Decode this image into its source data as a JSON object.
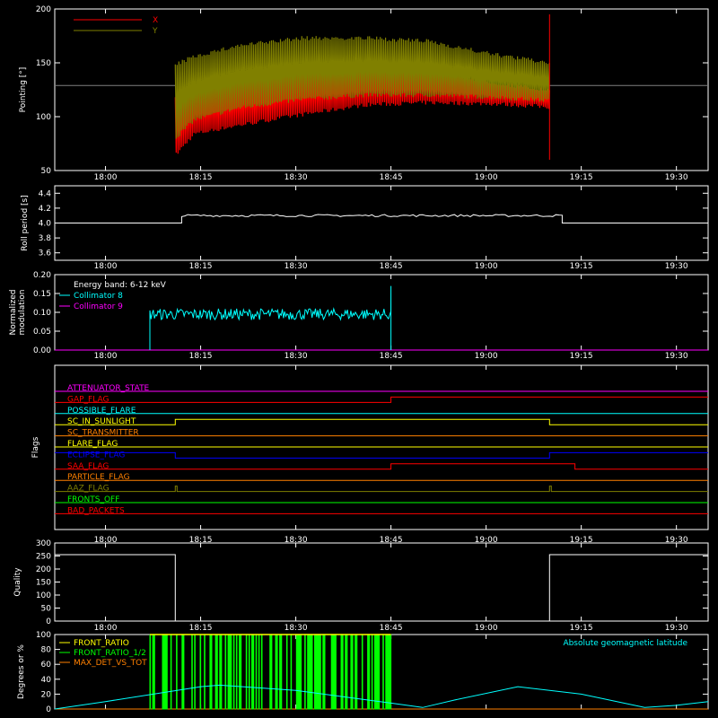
{
  "chart_data": [
    {
      "type": "line",
      "ylabel": "Pointing [°]",
      "ylim": [
        50,
        200
      ],
      "yticks": [
        50,
        100,
        150,
        200
      ],
      "legend": "top-left",
      "series": [
        {
          "name": "X",
          "color": "#ff0000",
          "baseline": 129,
          "start_time": "18:11",
          "end_time": "19:10",
          "lower": [
            [
              0,
              62
            ],
            [
              3,
              82
            ],
            [
              10,
              90
            ],
            [
              20,
              100
            ],
            [
              30,
              109
            ],
            [
              40,
              111
            ],
            [
              50,
              110
            ],
            [
              59,
              107
            ]
          ],
          "upper": [
            [
              0,
              118
            ],
            [
              3,
              130
            ],
            [
              10,
              138
            ],
            [
              20,
              145
            ],
            [
              30,
              147
            ],
            [
              40,
              145
            ],
            [
              50,
              134
            ],
            [
              59,
              126
            ]
          ]
        },
        {
          "name": "Y",
          "color": "#808000",
          "baseline": 129,
          "start_time": "18:11",
          "end_time": "19:10",
          "lower": [
            [
              0,
              78
            ],
            [
              3,
              95
            ],
            [
              10,
              106
            ],
            [
              20,
              114
            ],
            [
              30,
              118
            ],
            [
              40,
              118
            ],
            [
              50,
              116
            ],
            [
              59,
              113
            ]
          ],
          "upper": [
            [
              0,
              150
            ],
            [
              3,
              158
            ],
            [
              10,
              168
            ],
            [
              20,
              175
            ],
            [
              30,
              175
            ],
            [
              40,
              172
            ],
            [
              50,
              160
            ],
            [
              59,
              152
            ]
          ]
        }
      ]
    },
    {
      "type": "line",
      "ylabel": "Roll period [s]",
      "ylim": [
        3.5,
        4.5
      ],
      "yticks": [
        "3.6",
        "3.8",
        "4.0",
        "4.2",
        "4.4"
      ],
      "series": [
        {
          "name": "roll period",
          "color": "#ffffff",
          "level": 4.0,
          "noisy_start": "18:12",
          "noisy_end": "19:12",
          "noisy_level": 4.1
        }
      ]
    },
    {
      "type": "line",
      "ylabel_lines": [
        "Normalized",
        "modulation"
      ],
      "ylim": [
        0,
        0.2
      ],
      "yticks": [
        "0.00",
        "0.05",
        "0.10",
        "0.15",
        "0.20"
      ],
      "legend": "top-left",
      "annotation": "Energy band: 6-12 keV",
      "series": [
        {
          "name": "Collimator 8",
          "color": "#00ffff",
          "start_time": "18:07",
          "end_time": "18:45",
          "mean": 0.095,
          "spread": 0.015
        },
        {
          "name": "Collimator 9",
          "color": "#ff00ff",
          "level": 0.0
        }
      ]
    },
    {
      "type": "line",
      "ylabel": "Flags",
      "series": [
        {
          "name": "ATTENUATOR_STATE",
          "color": "#ff00ff",
          "steps": [
            [
              "17:52",
              0
            ],
            [
              "19:35",
              0
            ]
          ]
        },
        {
          "name": "GAP_FLAG",
          "color": "#ff0000",
          "steps": [
            [
              "17:52",
              0
            ],
            [
              "18:45",
              1
            ],
            [
              "19:35",
              1
            ]
          ]
        },
        {
          "name": "POSSIBLE_FLARE",
          "color": "#00ffff",
          "steps": [
            [
              "17:52",
              0
            ],
            [
              "19:35",
              0
            ]
          ]
        },
        {
          "name": "SC_IN_SUNLIGHT",
          "color": "#ffff00",
          "steps": [
            [
              "17:52",
              0
            ],
            [
              "18:11",
              1
            ],
            [
              "19:10",
              0
            ],
            [
              "19:35",
              0
            ]
          ]
        },
        {
          "name": "SC_TRANSMITTER",
          "color": "#ff8000",
          "steps": [
            [
              "17:52",
              0
            ],
            [
              "19:35",
              0
            ]
          ]
        },
        {
          "name": "FLARE_FLAG",
          "color": "#ffff00",
          "steps": [
            [
              "17:52",
              0
            ],
            [
              "19:35",
              0
            ]
          ]
        },
        {
          "name": "ECLIPSE_FLAG",
          "color": "#0000ff",
          "steps": [
            [
              "17:52",
              1
            ],
            [
              "18:11",
              0
            ],
            [
              "19:10",
              1
            ],
            [
              "19:35",
              1
            ]
          ]
        },
        {
          "name": "SAA_FLAG",
          "color": "#ff0000",
          "steps": [
            [
              "17:52",
              0
            ],
            [
              "18:45",
              1
            ],
            [
              "19:14",
              0
            ],
            [
              "19:35",
              0
            ]
          ]
        },
        {
          "name": "PARTICLE_FLAG",
          "color": "#ff8000",
          "steps": [
            [
              "17:52",
              0
            ],
            [
              "19:35",
              0
            ]
          ]
        },
        {
          "name": "AAZ_FLAG",
          "color": "#808000",
          "steps": [
            [
              "17:52",
              0
            ],
            [
              "19:35",
              0
            ]
          ],
          "spikes": [
            "18:11",
            "19:10"
          ]
        },
        {
          "name": "FRONTS_OFF",
          "color": "#00ff00",
          "steps": [
            [
              "17:52",
              0
            ],
            [
              "19:35",
              0
            ]
          ]
        },
        {
          "name": "BAD_PACKETS",
          "color": "#ff0000",
          "steps": [
            [
              "17:52",
              0
            ],
            [
              "19:35",
              0
            ]
          ]
        }
      ]
    },
    {
      "type": "line",
      "ylabel": "Quality",
      "ylim": [
        0,
        300
      ],
      "yticks": [
        "0",
        "50",
        "100",
        "150",
        "200",
        "250",
        "300"
      ],
      "series": [
        {
          "name": "Quality",
          "color": "#ffffff",
          "steps": [
            [
              "17:52",
              255
            ],
            [
              "18:11",
              0
            ],
            [
              "19:10",
              255
            ],
            [
              "19:35",
              255
            ]
          ]
        }
      ]
    },
    {
      "type": "line",
      "ylabel": "Degrees or %",
      "ylim": [
        0,
        100
      ],
      "yticks": [
        "0",
        "20",
        "40",
        "60",
        "80",
        "100"
      ],
      "legend": "top-left",
      "annotation": "Absolute geomagnetic latitude",
      "annotation_color": "#00ffff",
      "series": [
        {
          "name": "FRONT_RATIO",
          "color": "#ffff00",
          "start_time": "18:07",
          "end_time": "18:45",
          "level": 100
        },
        {
          "name": "FRONT_RATIO_1/2",
          "color": "#00ff00",
          "start_time": "18:07",
          "end_time": "18:45",
          "level": 100
        },
        {
          "name": "MAX_DET_VS_TOT",
          "color": "#ff8000",
          "level": 0
        },
        {
          "name": "Absolute geomagnetic latitude",
          "color": "#00ffff",
          "points": [
            [
              "17:52",
              0
            ],
            [
              "18:00",
              10
            ],
            [
              "18:15",
              30
            ],
            [
              "18:18",
              32
            ],
            [
              "18:30",
              25
            ],
            [
              "18:45",
              8
            ],
            [
              "18:50",
              2
            ],
            [
              "18:55",
              12
            ],
            [
              "19:05",
              30
            ],
            [
              "19:15",
              20
            ],
            [
              "19:25",
              2
            ],
            [
              "19:30",
              5
            ],
            [
              "19:35",
              10
            ]
          ]
        }
      ]
    }
  ],
  "x_axis": {
    "range": [
      "17:52",
      "19:35"
    ],
    "ticks": [
      "18:00",
      "18:15",
      "18:30",
      "18:45",
      "19:00",
      "19:15",
      "19:30"
    ]
  },
  "colors": {
    "background": "#000000",
    "axes": "#ffffff"
  }
}
